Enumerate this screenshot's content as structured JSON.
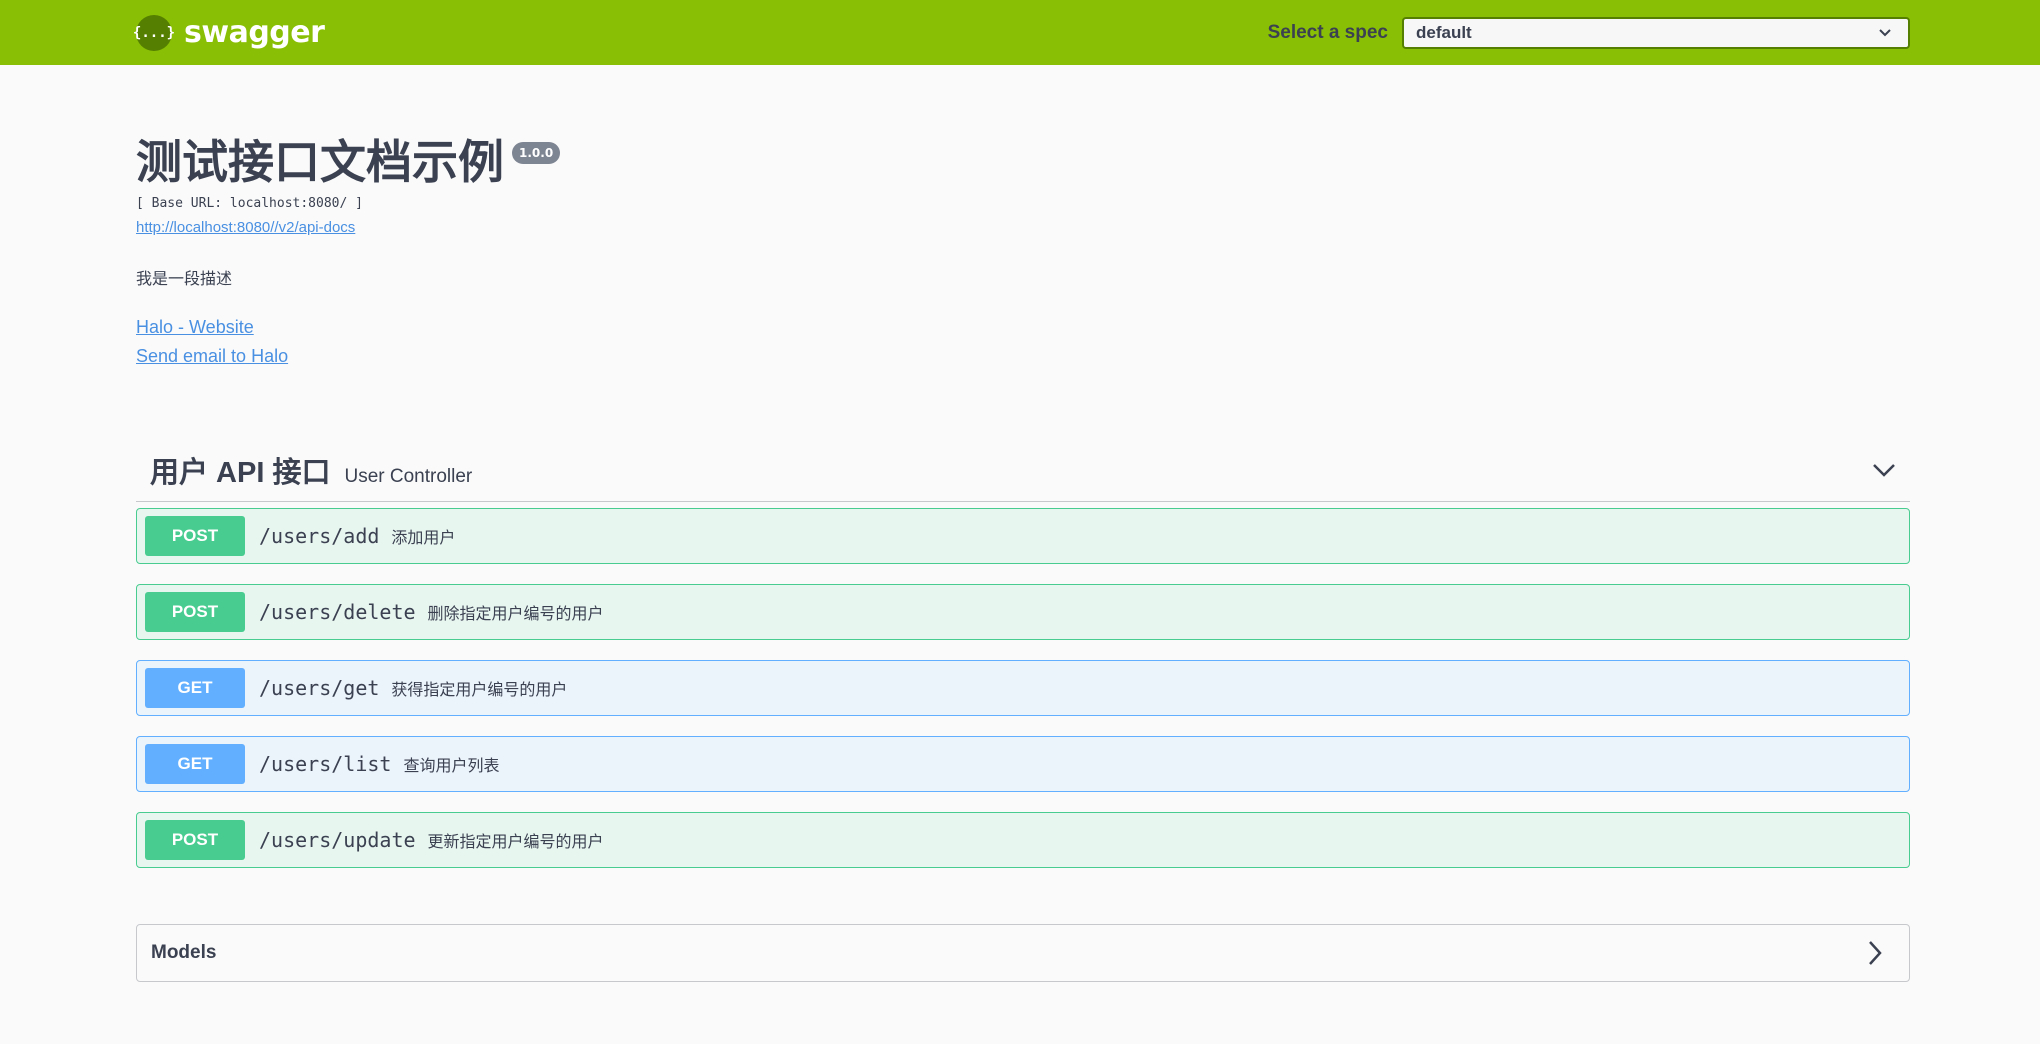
{
  "topbar": {
    "logo_glyph": "{...}",
    "brand": "swagger",
    "spec_label": "Select a spec",
    "spec_value": "default"
  },
  "info": {
    "title": "测试接口文档示例",
    "version": "1.0.0",
    "base_url": "[ Base URL: localhost:8080/ ]",
    "api_docs_link": "http://localhost:8080//v2/api-docs",
    "description": "我是一段描述",
    "contact_links": [
      "Halo - Website",
      "Send email to Halo"
    ]
  },
  "tag": {
    "name": "用户 API 接口",
    "description": "User Controller",
    "expanded": true
  },
  "operations": [
    {
      "method": "POST",
      "path": "/users/add",
      "summary": "添加用户"
    },
    {
      "method": "POST",
      "path": "/users/delete",
      "summary": "删除指定用户编号的用户"
    },
    {
      "method": "GET",
      "path": "/users/get",
      "summary": "获得指定用户编号的用户"
    },
    {
      "method": "GET",
      "path": "/users/list",
      "summary": "查询用户列表"
    },
    {
      "method": "POST",
      "path": "/users/update",
      "summary": "更新指定用户编号的用户"
    }
  ],
  "models": {
    "title": "Models",
    "expanded": false
  },
  "colors": {
    "topbar": "#89bf04",
    "post": "#49cc90",
    "get": "#61affe",
    "link": "#4990e2"
  }
}
